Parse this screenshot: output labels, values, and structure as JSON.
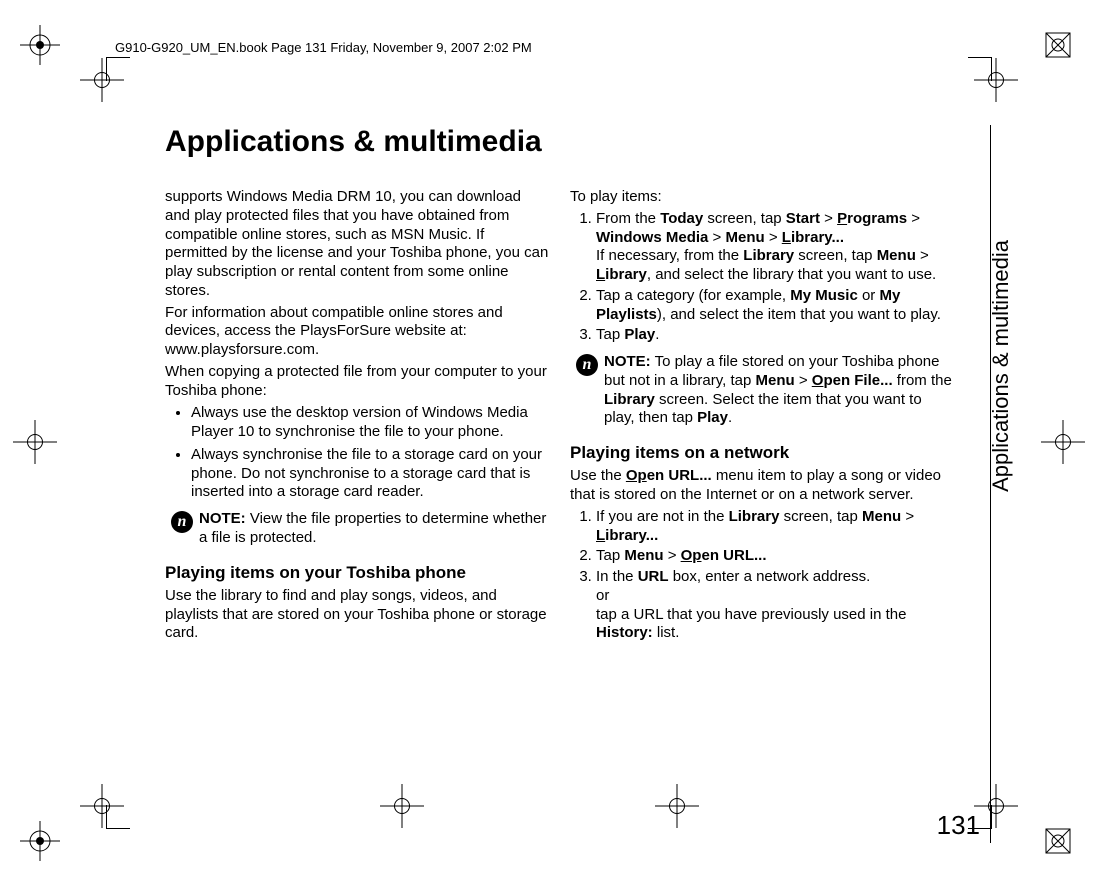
{
  "header_line": "G910-G920_UM_EN.book  Page 131  Friday, November 9, 2007  2:02 PM",
  "page_title": "Applications & multimedia",
  "side_label": "Applications & multimedia",
  "page_number": "131",
  "left_col": {
    "p1": "supports Windows Media DRM 10, you can download and play protected files that you have obtained from compatible online stores, such as MSN Music. If permitted by the license and your Toshiba phone, you can play subscription or rental content from some online stores.",
    "p2": "For information about compatible online stores and devices, access the PlaysForSure website at: www.playsforsure.com.",
    "p3": "When copying a protected file from your computer to your Toshiba phone:",
    "b1": "Always use the desktop version of Windows Media Player 10 to synchronise the file to your phone.",
    "b2": "Always synchronise the file to a storage card on your phone. Do not synchronise to a storage card that is inserted into a storage card reader.",
    "note_label": "NOTE:",
    "note_text": " View the file properties to determine whether a file is protected.",
    "sub1": "Playing items on your Toshiba phone",
    "p4": "Use the library to find and play songs, videos, and playlists that are stored on your Toshiba phone or storage card."
  },
  "right_col": {
    "intro": "To play items:",
    "s1_a": "From the ",
    "s1_b": "Today",
    "s1_c": " screen, tap ",
    "s1_d": "Start",
    "s1_e": " > ",
    "s1_f": "P",
    "s1_g": "rograms",
    "s1_h": " > ",
    "s1_i": "Windows Media",
    "s1_j": " > ",
    "s1_k": "Menu",
    "s1_l": " > ",
    "s1_m": "L",
    "s1_n": "ibrary...",
    "s1b_a": "If necessary, from the ",
    "s1b_b": "Library",
    "s1b_c": " screen, tap ",
    "s1b_d": "Menu",
    "s1b_e": " > ",
    "s1b_f": "L",
    "s1b_g": "ibrary",
    "s1b_h": ", and select the library that you want to use.",
    "s2_a": "Tap a category (for example, ",
    "s2_b": "My Music",
    "s2_c": " or ",
    "s2_d": "My Playlists",
    "s2_e": "), and select the item that you want to play.",
    "s3_a": "Tap ",
    "s3_b": "Play",
    "s3_c": ".",
    "note2_label": "NOTE:",
    "note2_a": " To play a file stored on your Toshiba phone but not in a library, tap ",
    "note2_b": "Menu",
    "note2_c": " > ",
    "note2_d": "O",
    "note2_e": "pen File...",
    "note2_f": " from the ",
    "note2_g": "Library",
    "note2_h": " screen. Select the item that you want to play, then tap ",
    "note2_i": "Play",
    "note2_j": ".",
    "sub2": "Playing items on a network",
    "p5_a": "Use the ",
    "p5_b": "Op",
    "p5_c": "en URL...",
    "p5_d": " menu item to play a song or video that is stored on the Internet or on a network server.",
    "n1_a": "If you are not in the ",
    "n1_b": "Library",
    "n1_c": " screen, tap ",
    "n1_d": "Menu",
    "n1_e": " > ",
    "n1_f": "L",
    "n1_g": "ibrary...",
    "n2_a": "Tap ",
    "n2_b": "Menu",
    "n2_c": " > ",
    "n2_d": "Op",
    "n2_e": "en URL...",
    "n3_a": "In the ",
    "n3_b": "URL",
    "n3_c": " box, enter a network address.",
    "n3_or": "or",
    "n3_d": "tap a URL that you have previously used in the ",
    "n3_e": "History:",
    "n3_f": " list."
  }
}
